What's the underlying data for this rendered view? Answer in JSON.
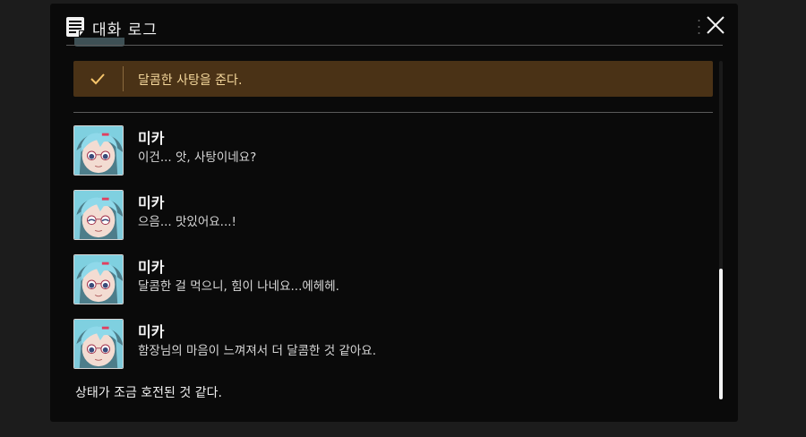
{
  "header": {
    "title": "대화 로그"
  },
  "choice": {
    "text": "달콤한 사탕을 준다."
  },
  "messages": [
    {
      "speaker": "미카",
      "text": "이건... 앗, 사탕이네요?"
    },
    {
      "speaker": "미카",
      "text": "으음... 맛있어요...!"
    },
    {
      "speaker": "미카",
      "text": "달콤한 걸 먹으니, 힘이 나네요...에헤헤."
    },
    {
      "speaker": "미카",
      "text": "함장님의 마음이 느껴져서 더 달콤한 것 같아요."
    }
  ],
  "narration": "상태가 조금 호전된 것 같다.",
  "colors": {
    "choice_background": "#4a3216",
    "choice_text": "#f5d89c",
    "panel_background": "#0a0a0a"
  },
  "icons": {
    "header": "log-icon",
    "close": "close-icon",
    "choice": "check-icon"
  }
}
